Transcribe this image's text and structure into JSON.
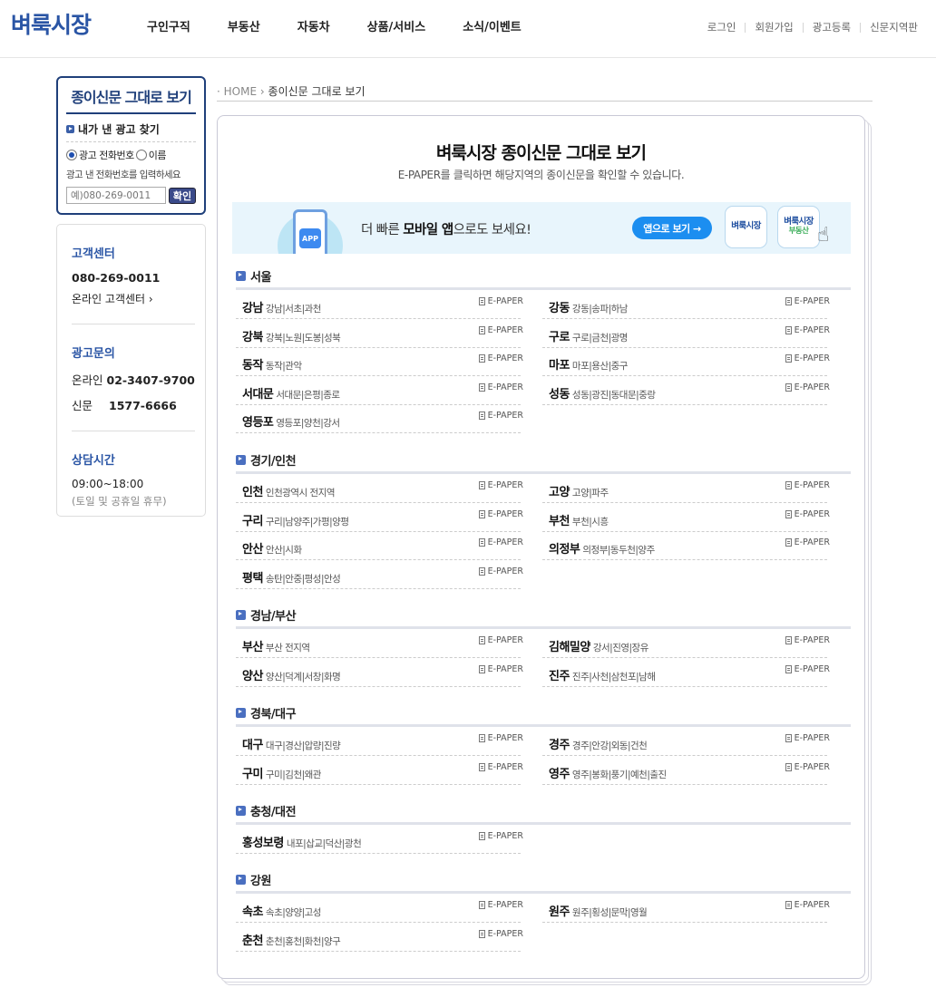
{
  "header": {
    "logo": "벼룩시장",
    "nav": [
      "구인구직",
      "부동산",
      "자동차",
      "상품/서비스",
      "소식/이벤트"
    ],
    "util": [
      "로그인",
      "회원가입",
      "광고등록",
      "신문지역판"
    ]
  },
  "sidebar": {
    "search": {
      "title": "종이신문 그대로 보기",
      "subtitle": "내가 낸 광고 찾기",
      "radio_phone": "광고 전화번호",
      "radio_name": "이름",
      "selected": "광고 전화번호",
      "help": "광고 낸 전화번호를 입력하세요",
      "placeholder": "예)080-269-0011",
      "confirm": "확인"
    },
    "customer": {
      "head": "고객센터",
      "phone": "080-269-0011",
      "online": "온라인 고객센터 ›"
    },
    "ad_inquiry": {
      "head": "광고문의",
      "online_label": "온라인",
      "online_phone": "02-3407-9700",
      "paper_label": "신문",
      "paper_phone": "1577-6666"
    },
    "hours": {
      "head": "상담시간",
      "time": "09:00~18:00",
      "note": "(토일 및 공휴일 휴무)"
    }
  },
  "breadcrumb": {
    "home": "HOME",
    "current": "종이신문 그대로 보기"
  },
  "main": {
    "title": "벼룩시장 종이신문 그대로 보기",
    "subtitle": "E-PAPER를 클릭하면 해당지역의 종이신문을 확인할 수 있습니다.",
    "banner": {
      "app_icon": "APP",
      "text_prefix": "더 빠른 ",
      "text_bold": "모바일 앱",
      "text_suffix": "으로도 보세요!",
      "button": "앱으로 보기 →",
      "app1": "벼룩시장",
      "app2_top": "벼룩시장",
      "app2_bottom": "부동산"
    },
    "epaper_label": "E-PAPER",
    "regions": [
      {
        "name": "서울",
        "items": [
          {
            "city": "강남",
            "districts": "강남|서초|과천"
          },
          {
            "city": "강동",
            "districts": "강동|송파|하남"
          },
          {
            "city": "강북",
            "districts": "강북|노원|도봉|성북"
          },
          {
            "city": "구로",
            "districts": "구로|금천|광명"
          },
          {
            "city": "동작",
            "districts": "동작|관악"
          },
          {
            "city": "마포",
            "districts": "마포|용산|중구"
          },
          {
            "city": "서대문",
            "districts": "서대문|은평|종로"
          },
          {
            "city": "성동",
            "districts": "성동|광진|동대문|중랑"
          },
          {
            "city": "영등포",
            "districts": "영등포|양천|강서"
          }
        ]
      },
      {
        "name": "경기/인천",
        "items": [
          {
            "city": "인천",
            "districts": "인천광역시 전지역"
          },
          {
            "city": "고양",
            "districts": "고양|파주"
          },
          {
            "city": "구리",
            "districts": "구리|남양주|가평|양평"
          },
          {
            "city": "부천",
            "districts": "부천|시흥"
          },
          {
            "city": "안산",
            "districts": "안산|시화"
          },
          {
            "city": "의정부",
            "districts": "의정부|동두천|양주"
          },
          {
            "city": "평택",
            "districts": "송탄|안중|평성|안성"
          }
        ]
      },
      {
        "name": "경남/부산",
        "items": [
          {
            "city": "부산",
            "districts": "부산 전지역"
          },
          {
            "city": "김해밀양",
            "districts": "강서|진영|장유"
          },
          {
            "city": "양산",
            "districts": "양산|덕계|서창|화명"
          },
          {
            "city": "진주",
            "districts": "진주|사천|삼천포|남해"
          }
        ]
      },
      {
        "name": "경북/대구",
        "items": [
          {
            "city": "대구",
            "districts": "대구|경산|압량|진량"
          },
          {
            "city": "경주",
            "districts": "경주|안강|외동|건천"
          },
          {
            "city": "구미",
            "districts": "구미|김천|왜관"
          },
          {
            "city": "영주",
            "districts": "영주|봉화|풍기|예천|출진"
          }
        ]
      },
      {
        "name": "충청/대전",
        "items": [
          {
            "city": "홍성보령",
            "districts": "내포|삽교|덕산|광천"
          }
        ]
      },
      {
        "name": "강원",
        "items": [
          {
            "city": "속초",
            "districts": "속초|양양|고성"
          },
          {
            "city": "원주",
            "districts": "원주|횡성|문막|영월"
          },
          {
            "city": "춘천",
            "districts": "춘천|홍천|화천|양구"
          }
        ]
      }
    ]
  }
}
